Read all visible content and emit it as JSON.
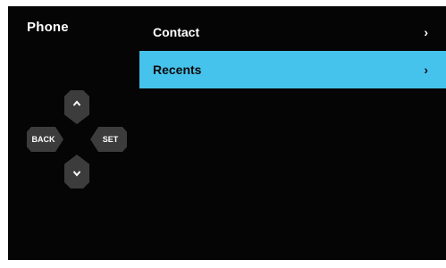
{
  "app": {
    "title": "Phone"
  },
  "menu": {
    "items": [
      {
        "label": "Contact",
        "chevron": "›",
        "selected": false
      },
      {
        "label": "Recents",
        "chevron": "›",
        "selected": true
      }
    ]
  },
  "dpad": {
    "up_icon": "chevron-up-icon",
    "down_icon": "chevron-down-icon",
    "back_label": "BACK",
    "set_label": "SET"
  },
  "colors": {
    "background": "#050505",
    "accent": "#46c3ec",
    "button": "#3c3c3c",
    "text": "#ffffff"
  }
}
